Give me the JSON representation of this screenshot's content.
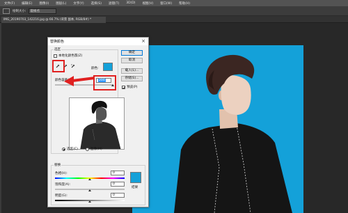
{
  "menubar": [
    "文件(F)",
    "编辑(E)",
    "图像(I)",
    "图层(L)",
    "文字(Y)",
    "选择(S)",
    "滤镜(T)",
    "3D(D)",
    "视图(V)",
    "窗口(W)",
    "帮助(H)"
  ],
  "options": {
    "label": "绘制大小:",
    "value": "取样点"
  },
  "doc_tab": "IMG_20190703_142216.jpg @ 66.7% (背景 副本, RGB/8#) *",
  "dialog": {
    "title": "替换颜色",
    "selection_group": "选区",
    "localized_clusters": "本地化颜色簇(Z)",
    "color_label": "颜色:",
    "fuzziness_label": "颜色容差(F):",
    "fuzziness_value": "200",
    "radio_selection": "选区(C)",
    "radio_image": "图像(M)",
    "replace_group": "替换",
    "hue_label": "色相(H):",
    "hue_value": "0",
    "sat_label": "饱和度(A):",
    "sat_value": "0",
    "light_label": "明度(G):",
    "light_value": "0",
    "result_label": "结果",
    "btn_ok": "确定",
    "btn_cancel": "取消",
    "btn_load": "载入(L)...",
    "btn_save": "存储(S)...",
    "preview_label": "预览(P)"
  },
  "colors": {
    "accent": "#14a1d9",
    "highlight": "#e02020"
  }
}
